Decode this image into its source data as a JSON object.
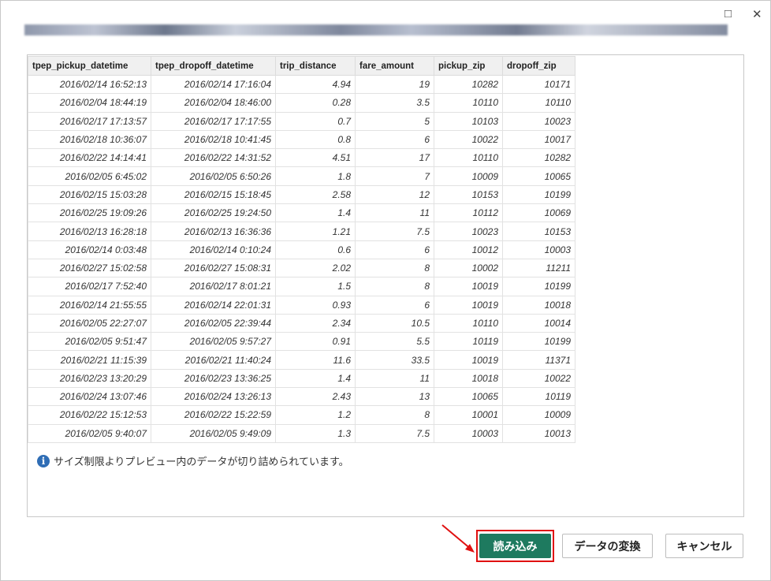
{
  "window": {
    "maximize_icon": "□",
    "close_icon": "✕"
  },
  "table": {
    "columns": [
      "tpep_pickup_datetime",
      "tpep_dropoff_datetime",
      "trip_distance",
      "fare_amount",
      "pickup_zip",
      "dropoff_zip"
    ],
    "rows": [
      [
        "2016/02/14 16:52:13",
        "2016/02/14 17:16:04",
        "4.94",
        "19",
        "10282",
        "10171"
      ],
      [
        "2016/02/04 18:44:19",
        "2016/02/04 18:46:00",
        "0.28",
        "3.5",
        "10110",
        "10110"
      ],
      [
        "2016/02/17 17:13:57",
        "2016/02/17 17:17:55",
        "0.7",
        "5",
        "10103",
        "10023"
      ],
      [
        "2016/02/18 10:36:07",
        "2016/02/18 10:41:45",
        "0.8",
        "6",
        "10022",
        "10017"
      ],
      [
        "2016/02/22 14:14:41",
        "2016/02/22 14:31:52",
        "4.51",
        "17",
        "10110",
        "10282"
      ],
      [
        "2016/02/05 6:45:02",
        "2016/02/05 6:50:26",
        "1.8",
        "7",
        "10009",
        "10065"
      ],
      [
        "2016/02/15 15:03:28",
        "2016/02/15 15:18:45",
        "2.58",
        "12",
        "10153",
        "10199"
      ],
      [
        "2016/02/25 19:09:26",
        "2016/02/25 19:24:50",
        "1.4",
        "11",
        "10112",
        "10069"
      ],
      [
        "2016/02/13 16:28:18",
        "2016/02/13 16:36:36",
        "1.21",
        "7.5",
        "10023",
        "10153"
      ],
      [
        "2016/02/14 0:03:48",
        "2016/02/14 0:10:24",
        "0.6",
        "6",
        "10012",
        "10003"
      ],
      [
        "2016/02/27 15:02:58",
        "2016/02/27 15:08:31",
        "2.02",
        "8",
        "10002",
        "11211"
      ],
      [
        "2016/02/17 7:52:40",
        "2016/02/17 8:01:21",
        "1.5",
        "8",
        "10019",
        "10199"
      ],
      [
        "2016/02/14 21:55:55",
        "2016/02/14 22:01:31",
        "0.93",
        "6",
        "10019",
        "10018"
      ],
      [
        "2016/02/05 22:27:07",
        "2016/02/05 22:39:44",
        "2.34",
        "10.5",
        "10110",
        "10014"
      ],
      [
        "2016/02/05 9:51:47",
        "2016/02/05 9:57:27",
        "0.91",
        "5.5",
        "10119",
        "10199"
      ],
      [
        "2016/02/21 11:15:39",
        "2016/02/21 11:40:24",
        "11.6",
        "33.5",
        "10019",
        "11371"
      ],
      [
        "2016/02/23 13:20:29",
        "2016/02/23 13:36:25",
        "1.4",
        "11",
        "10018",
        "10022"
      ],
      [
        "2016/02/24 13:07:46",
        "2016/02/24 13:26:13",
        "2.43",
        "13",
        "10065",
        "10119"
      ],
      [
        "2016/02/22 15:12:53",
        "2016/02/22 15:22:59",
        "1.2",
        "8",
        "10001",
        "10009"
      ],
      [
        "2016/02/05 9:40:07",
        "2016/02/05 9:49:09",
        "1.3",
        "7.5",
        "10003",
        "10013"
      ]
    ]
  },
  "info": {
    "icon": "i",
    "text": "サイズ制限よりプレビュー内のデータが切り詰められています。"
  },
  "buttons": {
    "load": "読み込み",
    "transform": "データの変換",
    "cancel": "キャンセル"
  },
  "colors": {
    "primary": "#1e7a5f",
    "highlight": "#e01010"
  }
}
